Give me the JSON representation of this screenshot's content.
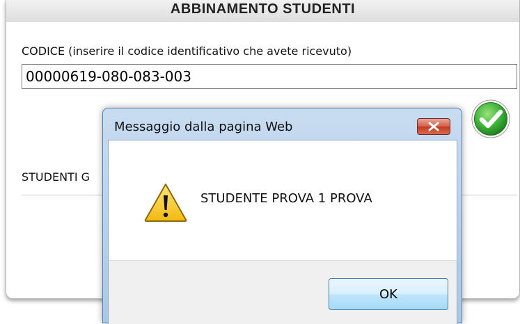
{
  "page": {
    "title": "ABBINAMENTO STUDENTI",
    "code_label": "CODICE (inserire il codice identificativo che avete ricevuto)",
    "code_value": "00000619-080-083-003",
    "students_label": "STUDENTI G"
  },
  "dialog": {
    "title": "Messaggio dalla pagina Web",
    "message": "STUDENTE PROVA 1 PROVA",
    "ok_label": "OK",
    "icon": "warning-icon"
  },
  "icons": {
    "check": "check-circle-icon",
    "close": "close-icon",
    "warning": "warning-icon"
  },
  "colors": {
    "check_green": "#2fa52f",
    "warning_yellow": "#f6c619",
    "close_red": "#c8412a"
  }
}
